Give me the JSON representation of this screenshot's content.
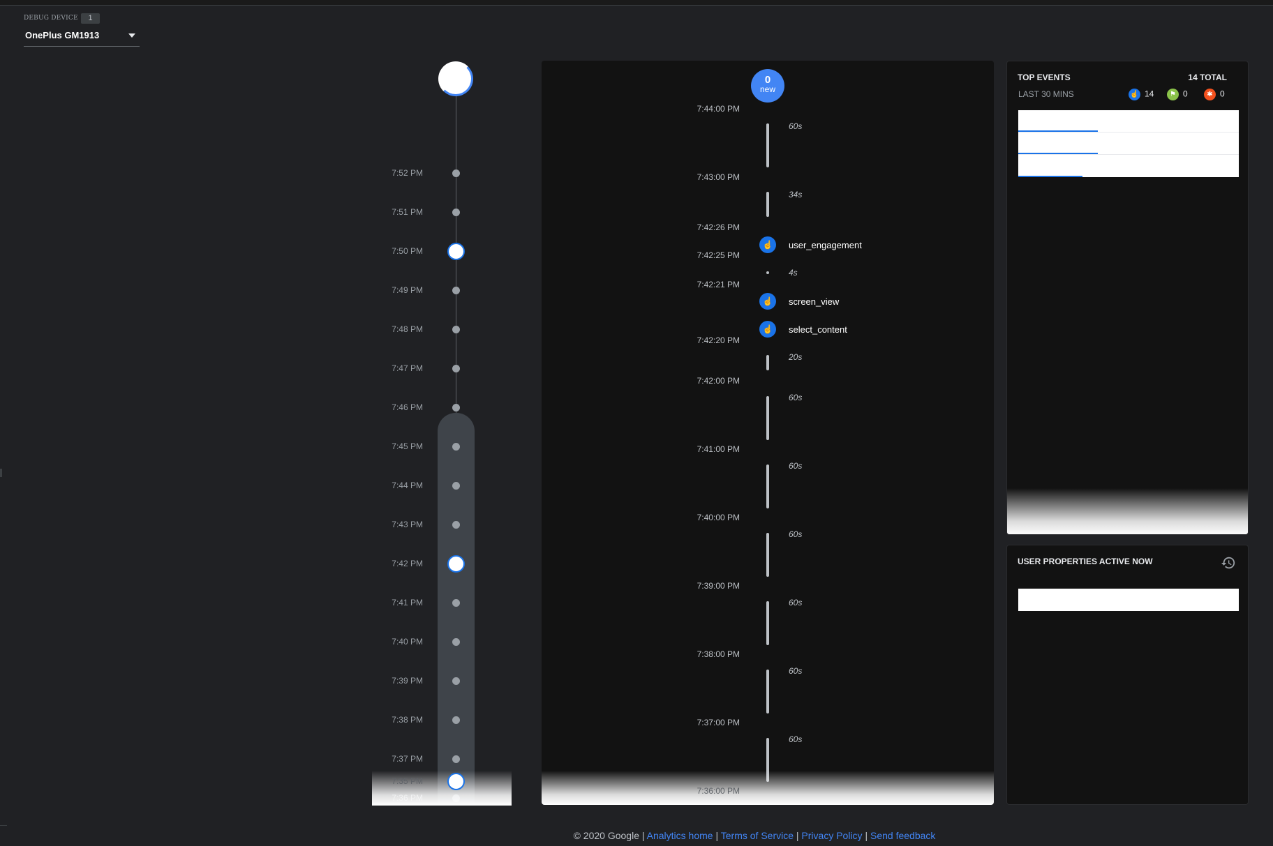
{
  "debug_device": {
    "label": "DEBUG DEVICE",
    "count": "1",
    "selected": "OnePlus GM1913"
  },
  "minutes": [
    {
      "time": "7:52 PM",
      "active": false
    },
    {
      "time": "7:51 PM",
      "active": false
    },
    {
      "time": "7:50 PM",
      "active": true
    },
    {
      "time": "7:49 PM",
      "active": false
    },
    {
      "time": "7:48 PM",
      "active": false
    },
    {
      "time": "7:47 PM",
      "active": false
    },
    {
      "time": "7:46 PM",
      "active": false
    },
    {
      "time": "7:45 PM",
      "active": false
    },
    {
      "time": "7:44 PM",
      "active": false
    },
    {
      "time": "7:43 PM",
      "active": false
    },
    {
      "time": "7:42 PM",
      "active": true
    },
    {
      "time": "7:41 PM",
      "active": false
    },
    {
      "time": "7:40 PM",
      "active": false
    },
    {
      "time": "7:39 PM",
      "active": false
    },
    {
      "time": "7:38 PM",
      "active": false
    },
    {
      "time": "7:37 PM",
      "active": false
    },
    {
      "time": "7:36 PM",
      "active": false
    },
    {
      "time": "7:35 PM",
      "active": true
    }
  ],
  "stream": {
    "new_count": "0",
    "new_label": "new",
    "timestamps": [
      "7:44:00 PM",
      "7:43:00 PM",
      "7:42:26 PM",
      "7:42:25 PM",
      "7:42:21 PM",
      "7:42:20 PM",
      "7:42:00 PM",
      "7:41:00 PM",
      "7:40:00 PM",
      "7:39:00 PM",
      "7:38:00 PM",
      "7:37:00 PM",
      "7:36:00 PM"
    ],
    "gaps": [
      "60s",
      "34s",
      "4s",
      "20s",
      "60s",
      "60s",
      "60s",
      "60s",
      "60s",
      "60s"
    ],
    "events": [
      "user_engagement",
      "screen_view",
      "select_content"
    ]
  },
  "top_events": {
    "title": "TOP EVENTS",
    "total": "14 TOTAL",
    "subtitle": "LAST 30 MINS",
    "counts": {
      "events": "14",
      "conversions": "0",
      "errors": "0"
    },
    "bar_fractions": [
      0.36,
      0.36,
      0.29
    ]
  },
  "user_properties": {
    "title": "USER PROPERTIES ACTIVE NOW"
  },
  "footer": {
    "copyright": "© 2020 Google",
    "links": [
      "Analytics home",
      "Terms of Service",
      "Privacy Policy",
      "Send feedback"
    ]
  },
  "colors": {
    "accent": "#1a73e8",
    "event_blue": "#4285f4",
    "conversion_green": "#8bc34a",
    "error_red": "#f4511e"
  },
  "icons": {
    "event": "touch-icon",
    "conversion": "flag-icon",
    "error": "bug-icon",
    "history": "history-icon",
    "dropdown": "caret-down-icon"
  }
}
